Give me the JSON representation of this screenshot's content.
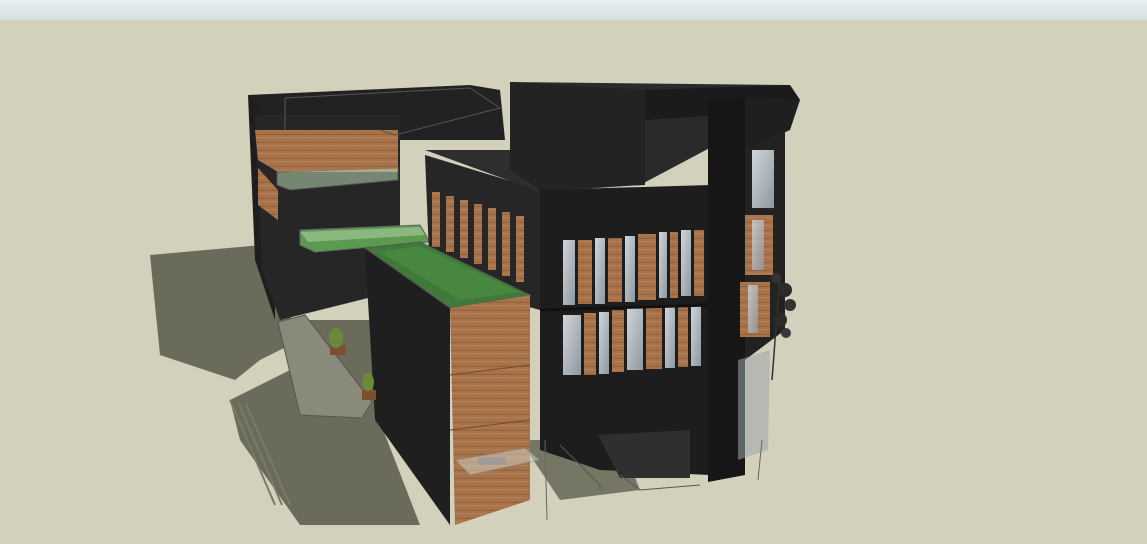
{
  "viewport": {
    "sky_color": "#dde8e8",
    "ground_color": "#d3d1bb"
  },
  "model": {
    "colors": {
      "shadow": "#6b6b5b",
      "facade_dark": "#2a2a2a",
      "facade_darker": "#1c1c1c",
      "wood": "#a8734a",
      "grass": "#3f7a3a",
      "glass": "#aeb6bd"
    },
    "icons": [
      "tree-icon",
      "planter-icon"
    ]
  }
}
